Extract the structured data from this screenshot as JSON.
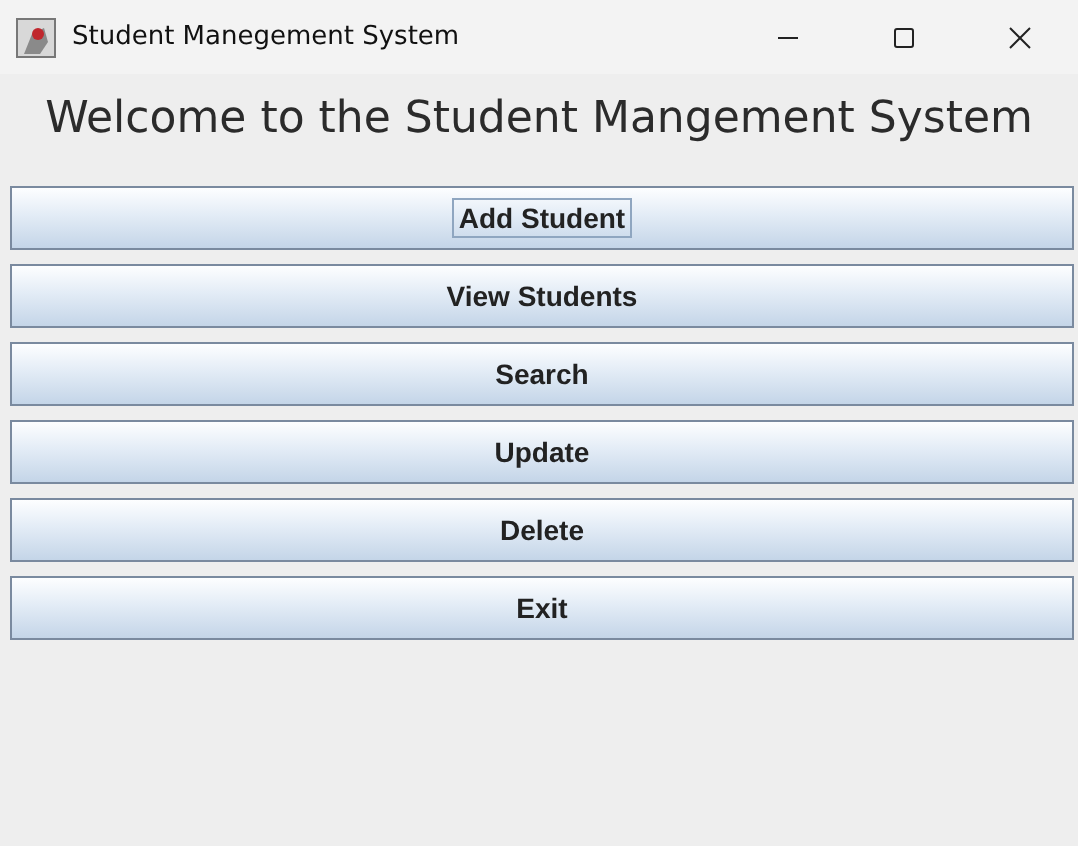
{
  "window": {
    "title": "Student Manegement System"
  },
  "heading": "Welcome to the Student Mangement System",
  "buttons": [
    {
      "label": "Add Student",
      "focused": true
    },
    {
      "label": "View Students",
      "focused": false
    },
    {
      "label": "Search",
      "focused": false
    },
    {
      "label": "Update",
      "focused": false
    },
    {
      "label": "Delete",
      "focused": false
    },
    {
      "label": "Exit",
      "focused": false
    }
  ]
}
